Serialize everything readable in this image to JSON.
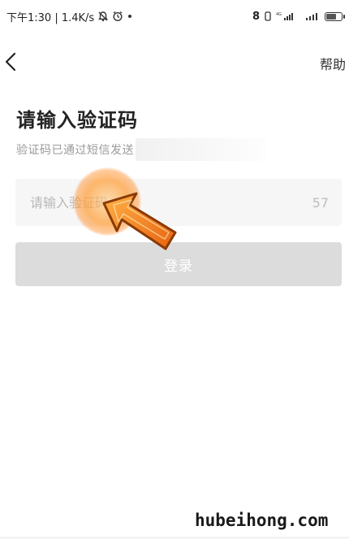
{
  "status_bar": {
    "time_speed": "下午1:30 | 1.4K/s",
    "right_text": "8",
    "network_label": "4G",
    "battery_level": 0.7
  },
  "nav": {
    "back_icon": "chevron-left-icon",
    "help_label": "帮助"
  },
  "page": {
    "title": "请输入验证码",
    "subtitle": "验证码已通过短信发送"
  },
  "code_field": {
    "placeholder": "请输入验证码",
    "value": "",
    "countdown": "57"
  },
  "login_button": {
    "label": "登录"
  },
  "watermark": {
    "text": "hubeihong.com"
  },
  "colors": {
    "field_bg": "#f6f6f6",
    "button_disabled_bg": "#dcdcdc",
    "subtitle": "#9a9a9a",
    "arrow_orange": "#f07a1a"
  }
}
